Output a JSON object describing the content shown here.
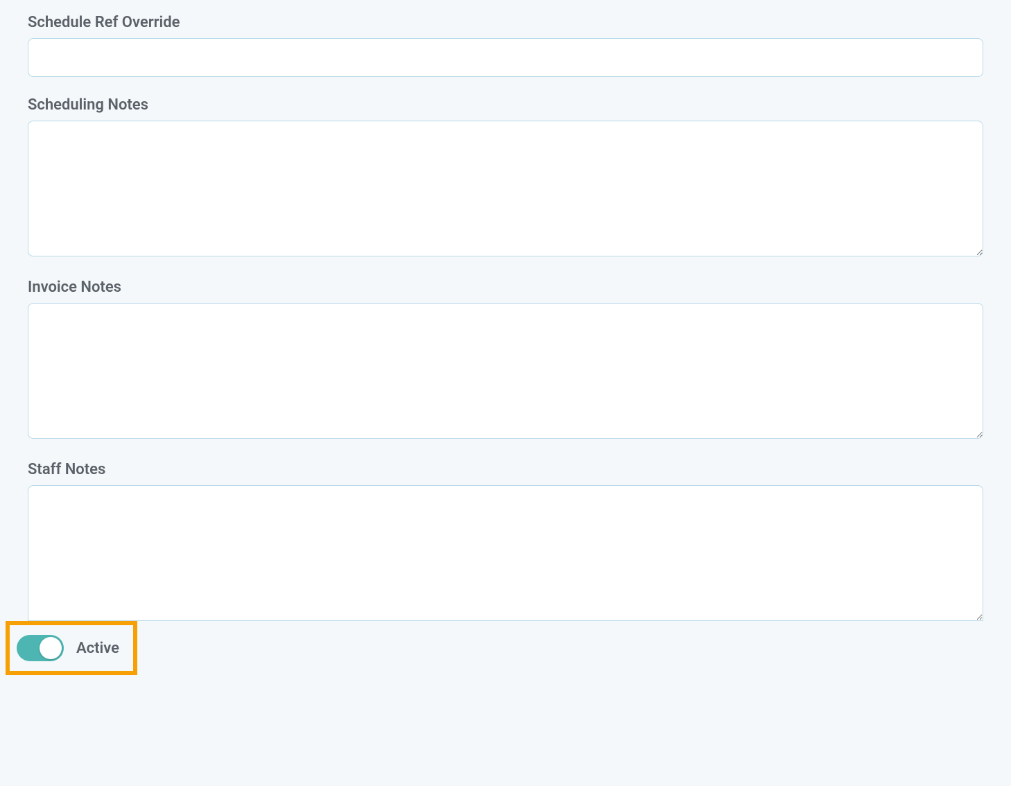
{
  "fields": {
    "schedule_ref_override": {
      "label": "Schedule Ref Override",
      "value": ""
    },
    "scheduling_notes": {
      "label": "Scheduling Notes",
      "value": ""
    },
    "invoice_notes": {
      "label": "Invoice Notes",
      "value": ""
    },
    "staff_notes": {
      "label": "Staff Notes",
      "value": ""
    }
  },
  "toggle": {
    "label": "Active",
    "state": true
  }
}
